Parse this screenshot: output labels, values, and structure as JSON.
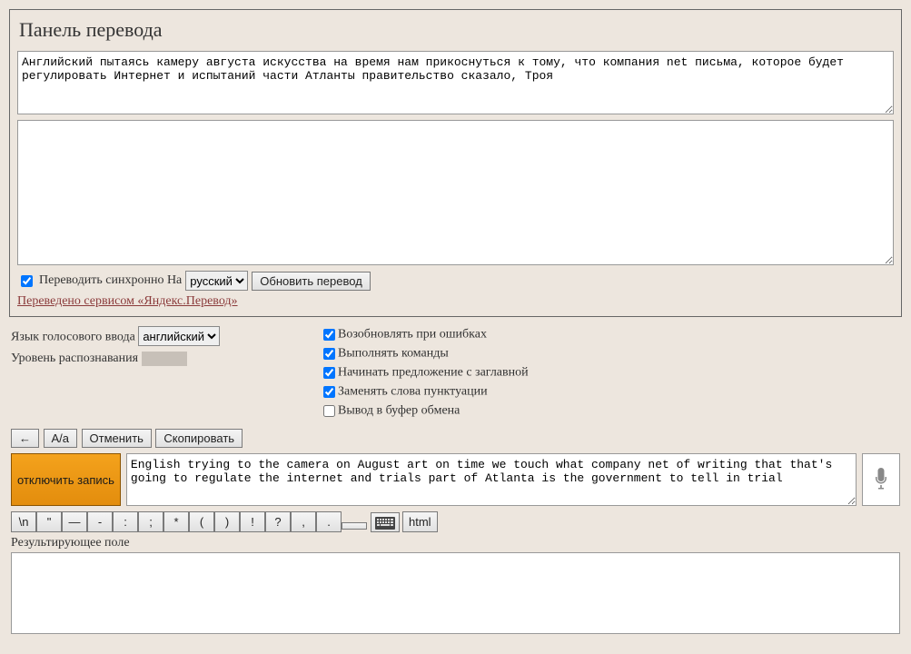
{
  "panel": {
    "title": "Панель перевода",
    "translated_text": "Английский пытаясь камеру августа искусства на время нам прикоснуться к тому, что компания net письма, которое будет регулировать Интернет и испытаний части Атланты правительство сказало, Троя",
    "source_text": "",
    "sync_label": "Переводить синхронно На",
    "lang_select": "русский",
    "refresh_btn": "Обновить перевод",
    "credit_link": "Переведено сервисом «Яндекс.Перевод»"
  },
  "settings": {
    "voice_lang_label": "Язык голосового ввода",
    "voice_lang_select": "английский",
    "recog_level_label": "Уровень распознавания",
    "opts": {
      "resume": "Возобновлять при ошибках",
      "cmds": "Выполнять команды",
      "capital": "Начинать предложение с заглавной",
      "punct": "Заменять слова пунктуации",
      "clip": "Вывод в буфер обмена"
    }
  },
  "toolbar": {
    "back": "←",
    "case": "А/а",
    "undo": "Отменить",
    "copy": "Скопировать"
  },
  "record": {
    "stop_btn": "отключить запись",
    "text": "English trying to the camera on August art on time we touch what company net of writing that that's going to regulate the internet and trials part of Atlanta is the government to tell in trial"
  },
  "symbols": [
    "\\n",
    "\"",
    "—",
    "-",
    ":",
    ";",
    "*",
    "(",
    ")",
    "!",
    "?",
    ",",
    ".",
    " "
  ],
  "html_btn": "html",
  "result_label": "Результирующее поле"
}
